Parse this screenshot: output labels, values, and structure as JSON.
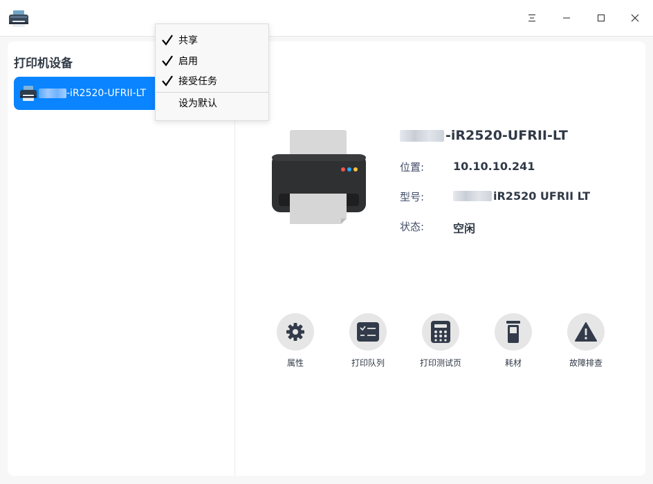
{
  "window": {
    "icons": {
      "app": "printer-app-icon",
      "menu": "hamburger-menu-icon",
      "minimize": "minimize-icon",
      "maximize": "maximize-icon",
      "close": "close-icon"
    }
  },
  "sidebar": {
    "title": "打印机设备",
    "devices": [
      {
        "name": "-iR2520-UFRII-LT",
        "selected": true
      }
    ]
  },
  "context_menu": {
    "items": [
      {
        "label": "共享",
        "checked": true
      },
      {
        "label": "启用",
        "checked": true
      },
      {
        "label": "接受任务",
        "checked": true
      },
      {
        "label": "设为默认",
        "checked": false
      }
    ]
  },
  "detail": {
    "printer_name": "-iR2520-UFRII-LT",
    "location_label": "位置:",
    "location_value": "10.10.10.241",
    "model_label": "型号:",
    "model_value": "iR2520 UFRII LT",
    "status_label": "状态:",
    "status_value": "空闲"
  },
  "actions": [
    {
      "label": "属性",
      "icon": "gear-icon"
    },
    {
      "label": "打印队列",
      "icon": "print-queue-icon"
    },
    {
      "label": "打印测试页",
      "icon": "test-page-icon"
    },
    {
      "label": "耗材",
      "icon": "supplies-icon"
    },
    {
      "label": "故障排查",
      "icon": "troubleshoot-warning-icon"
    }
  ],
  "colors": {
    "accent": "#0a84ff",
    "printer_body": "#2f3032",
    "dot_red": "#f2564b",
    "dot_blue": "#2fa6f5",
    "dot_yellow": "#f8c33e"
  }
}
